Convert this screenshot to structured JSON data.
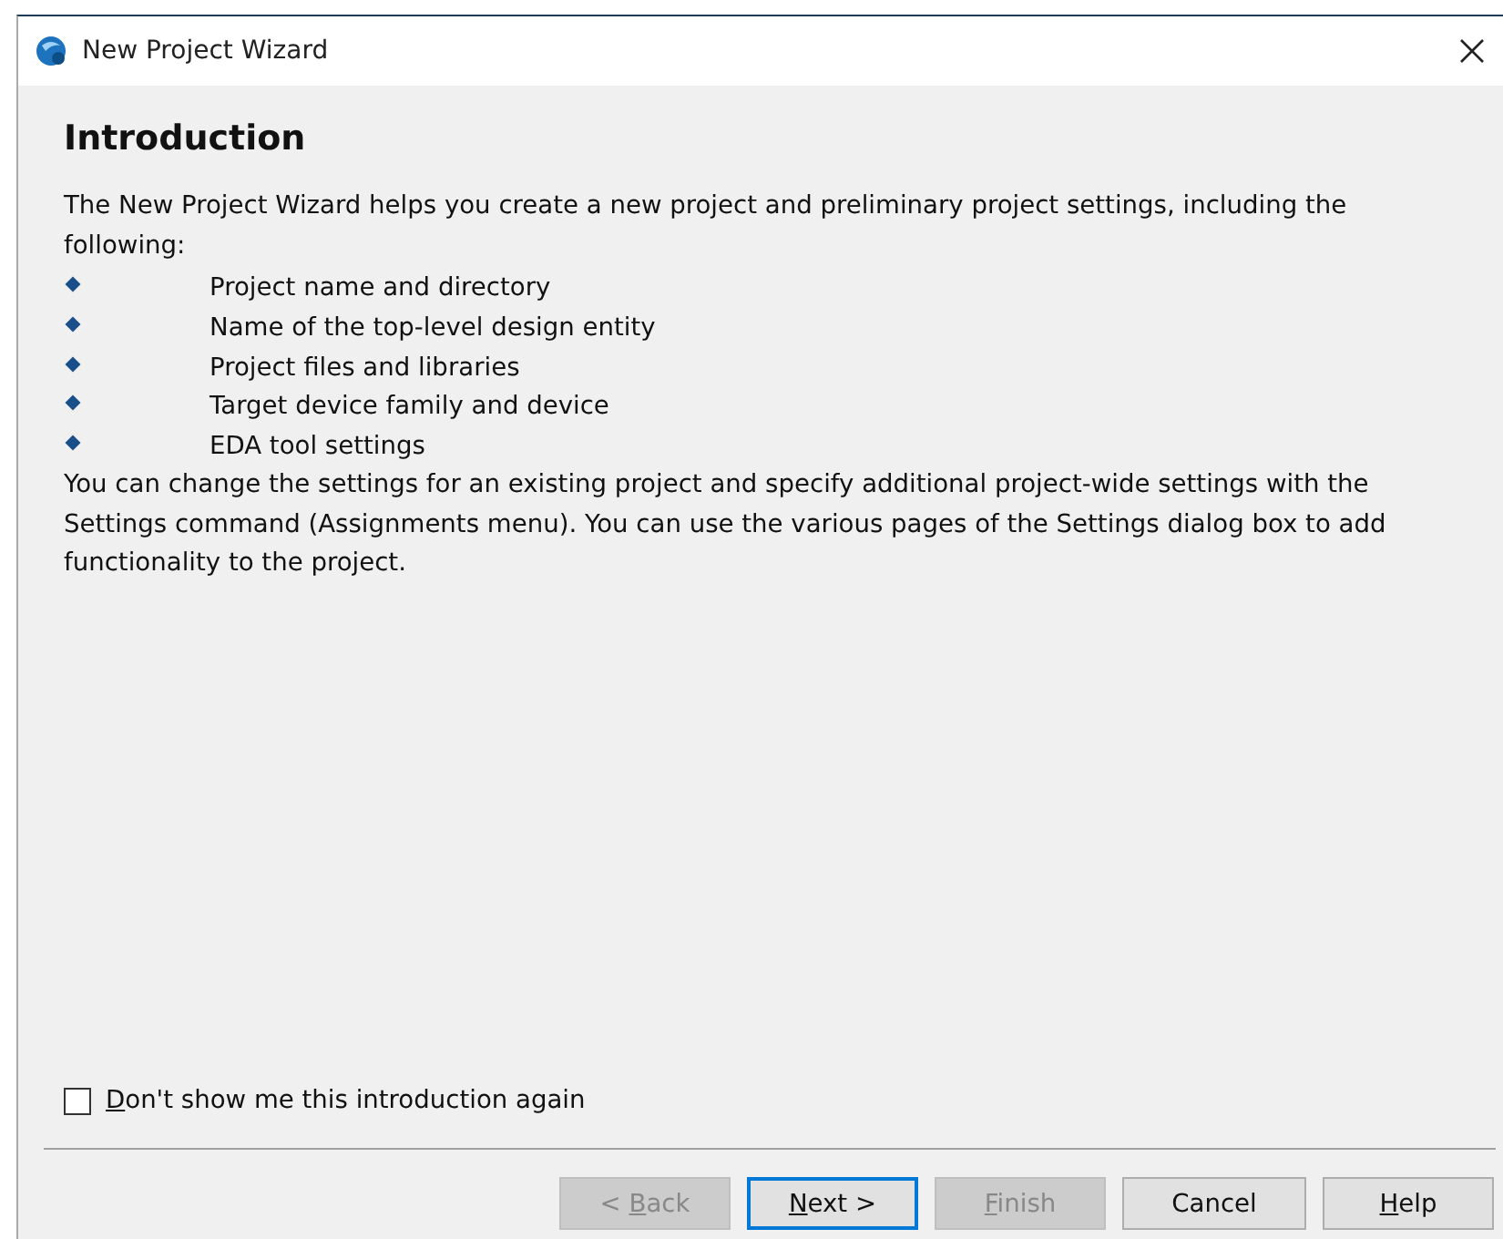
{
  "window": {
    "title": "New Project Wizard"
  },
  "heading": "Introduction",
  "intro": "The New Project Wizard helps you create a new project and preliminary project settings, including the following:",
  "bullets": [
    "Project name and directory",
    "Name of the top-level design entity",
    "Project files and libraries",
    "Target device family and device",
    "EDA tool settings"
  ],
  "note": "You can change the settings for an existing project and specify additional project-wide settings with the Settings command (Assignments menu). You can use the various pages of the Settings dialog box to add functionality to the project.",
  "checkbox": {
    "key": "D",
    "after": "on't show me this introduction again",
    "checked": false
  },
  "buttons": [
    {
      "before": "< ",
      "key": "B",
      "after": "ack",
      "disabled": true,
      "default": false
    },
    {
      "key": "N",
      "after": "ext >",
      "disabled": false,
      "default": true
    },
    {
      "key": "F",
      "after": "inish",
      "disabled": true,
      "default": false
    },
    {
      "before": "Cancel",
      "disabled": false,
      "default": false
    },
    {
      "key": "H",
      "after": "elp",
      "disabled": false,
      "default": false
    }
  ]
}
